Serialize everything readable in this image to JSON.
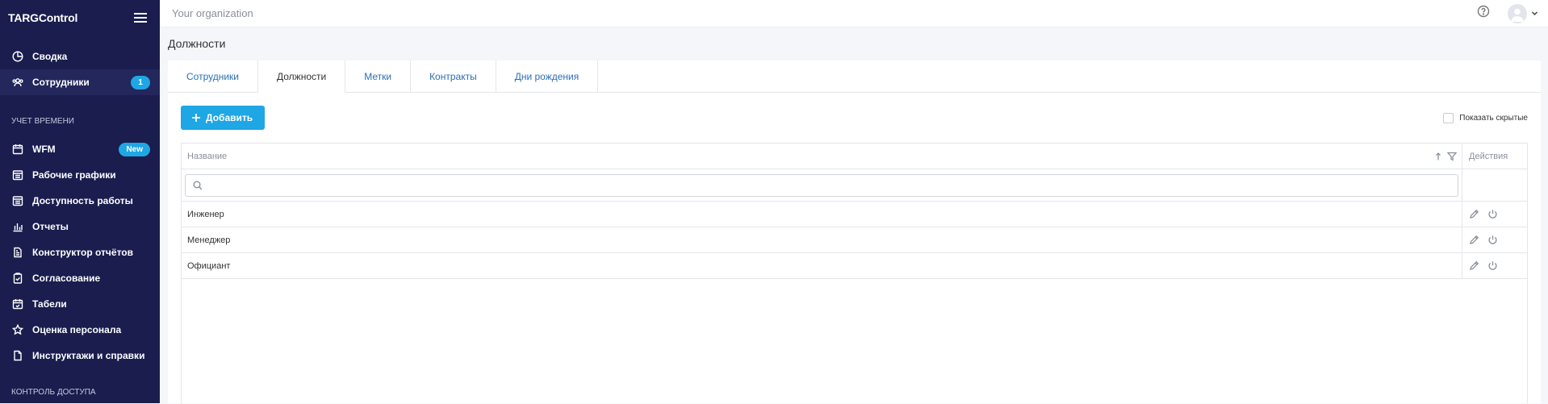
{
  "app": {
    "title": "TARGControl"
  },
  "sidebar": {
    "items_top": [
      {
        "label": "Сводка",
        "icon": "pie-chart-icon"
      },
      {
        "label": "Сотрудники",
        "icon": "users-icon",
        "badge": "1"
      }
    ],
    "section_time": "УЧЕТ ВРЕМЕНИ",
    "items_time": [
      {
        "label": "WFM",
        "icon": "calendar-icon",
        "badge": "New"
      },
      {
        "label": "Рабочие графики",
        "icon": "schedule-icon"
      },
      {
        "label": "Доступность работы",
        "icon": "availability-icon"
      },
      {
        "label": "Отчеты",
        "icon": "bar-chart-icon"
      },
      {
        "label": "Конструктор отчётов",
        "icon": "report-builder-icon"
      },
      {
        "label": "Согласование",
        "icon": "clipboard-check-icon"
      },
      {
        "label": "Табели",
        "icon": "timesheet-icon"
      },
      {
        "label": "Оценка персонала",
        "icon": "star-icon"
      },
      {
        "label": "Инструктажи и справки",
        "icon": "document-icon"
      }
    ],
    "section_access": "КОНТРОЛЬ ДОСТУПА"
  },
  "topbar": {
    "org": "Your organization"
  },
  "page": {
    "title": "Должности"
  },
  "tabs": [
    {
      "label": "Сотрудники"
    },
    {
      "label": "Должности"
    },
    {
      "label": "Метки"
    },
    {
      "label": "Контракты"
    },
    {
      "label": "Дни рождения"
    }
  ],
  "toolbar": {
    "add_label": "Добавить",
    "show_hidden_label": "Показать скрытые"
  },
  "grid": {
    "col_name": "Название",
    "col_actions": "Действия",
    "rows": [
      {
        "name": "Инженер"
      },
      {
        "name": "Менеджер"
      },
      {
        "name": "Официант"
      }
    ]
  },
  "colors": {
    "accent": "#1ea7e4",
    "sidebar_bg": "#1a1d4e",
    "link": "#2b6fb6"
  }
}
